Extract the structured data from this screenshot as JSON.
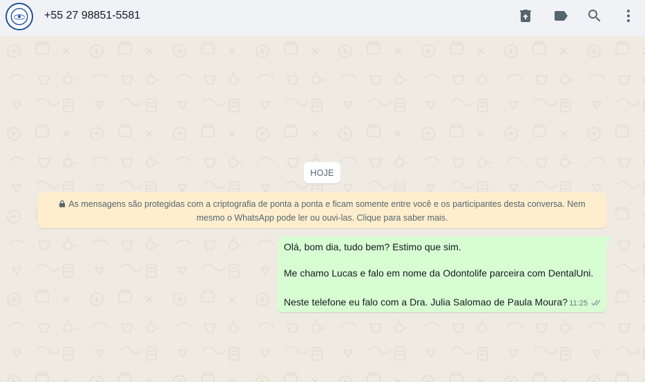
{
  "header": {
    "contact_name": "+55 27 98851-5581",
    "avatar_icon": "clinic-logo-avatar",
    "actions": [
      {
        "name": "delete-chat",
        "icon": "trash-icon"
      },
      {
        "name": "label",
        "icon": "label-tag-icon"
      },
      {
        "name": "search",
        "icon": "search-icon"
      },
      {
        "name": "menu",
        "icon": "more-vertical-icon"
      }
    ]
  },
  "chat": {
    "date_divider": "HOJE",
    "encryption_notice": {
      "icon": "lock-icon",
      "text": "As mensagens são protegidas com a criptografia de ponta a ponta e ficam somente entre você e os participantes desta conversa. Nem mesmo o WhatsApp pode ler ou ouvi-las. Clique para saber mais."
    },
    "messages": [
      {
        "direction": "outgoing",
        "lines": [
          "Olá, bom dia, tudo bem? Estimo que sim.",
          "Me chamo Lucas e falo em nome da Odontolife parceira com DentalUni.",
          "Neste telefone eu falo com a Dra. Julia Salomao de Paula Moura?"
        ],
        "time": "11:25",
        "status_icon": "double-check-icon"
      }
    ]
  },
  "colors": {
    "header_bg": "#f0f2f5",
    "chat_bg": "#efeae2",
    "outgoing_bubble": "#d9fdd3",
    "notice_bg": "#ffeecd",
    "icon_gray": "#54656f"
  }
}
